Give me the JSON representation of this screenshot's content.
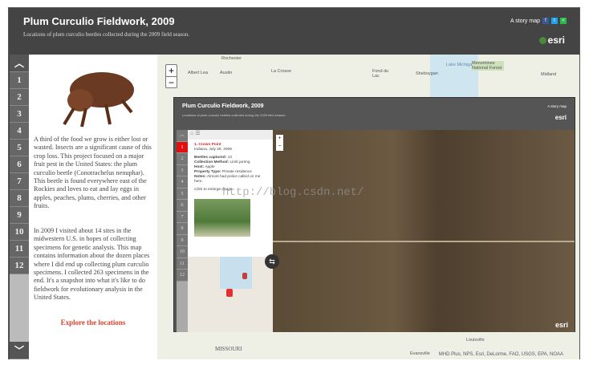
{
  "header": {
    "title": "Plum Curculio Fieldwork, 2009",
    "subtitle": "Locations of plum curculio beetles collected during the 2009 field season.",
    "story_map": "A story map",
    "logo": "esri",
    "social": [
      "facebook-icon",
      "twitter-icon",
      "share-icon"
    ]
  },
  "nav": {
    "items": [
      "1",
      "2",
      "3",
      "4",
      "5",
      "6",
      "7",
      "8",
      "9",
      "10",
      "11",
      "12"
    ]
  },
  "panel": {
    "paragraph1": "A third of the food we grow is either lost or wasted. Insects are a significant cause of this crop loss. This project focused on a major fruit pest in the United States: the plum curculio beetle (Conotrachelus nenuphar). This beetle is found everywhere east of the Rockies and loves to eat and lay eggs in apples, peaches, plums, cherries, and other fruits.",
    "paragraph2": "In 2009 I visited about 14 sites in the midwestern U.S. in hopes of collecting specimens for genetic analysis. This map contains information about the dozen places where I did end up collecting plum curculio specimens. I collected 263 specimens in the end. It's a snapshot into what it's like to do fieldwork for evolutionary analysis in the United States.",
    "link": "Explore the locations"
  },
  "map": {
    "labels": [
      "Rochester",
      "Albert Lea",
      "Austin",
      "La Crosse",
      "Fond du Lac",
      "Sheboygan",
      "Lake Michigan",
      "Menominee National Forest",
      "Midland",
      "MISSOURI",
      "Louisville",
      "Evansville"
    ],
    "attribution": "MHD Plus, NPS, Esri, DeLorme, FAO, USGS, EPA, NOAA",
    "zoom_in": "+",
    "zoom_out": "−"
  },
  "inset": {
    "title": "Plum Curculio Fieldwork, 2009",
    "subtitle": "Locations of plum curculio beetles collected during the 2009 field season.",
    "story_map": "A story map",
    "logo": "esri",
    "place": "1. Crown Point",
    "place_sub": "Indiana, July 26, 2009",
    "fields": [
      {
        "k": "Beetles captured:",
        "v": "13"
      },
      {
        "k": "Collection Method:",
        "v": "Limb jarring"
      },
      {
        "k": "Host:",
        "v": "Apple"
      },
      {
        "k": "Property Type:",
        "v": "Private residence"
      },
      {
        "k": "Notes:",
        "v": "Almost had police called on me here."
      }
    ],
    "caption": "Click to enlarge image"
  },
  "watermark": "http://blog.csdn.net/"
}
